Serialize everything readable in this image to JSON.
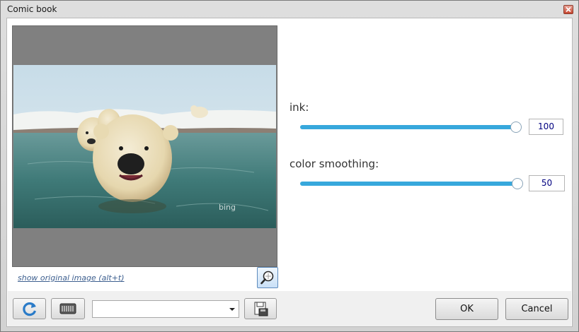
{
  "window": {
    "title": "Comic book"
  },
  "preview": {
    "show_original_label": "show original image (alt+t)",
    "watermark": "bing"
  },
  "params": {
    "ink": {
      "label": "ink:",
      "value": "100",
      "fraction": 1.0
    },
    "color_smoothing": {
      "label": "color smoothing:",
      "value": "50",
      "fraction": 1.0
    }
  },
  "footer": {
    "preset_value": "",
    "ok_label": "OK",
    "cancel_label": "Cancel"
  },
  "icons": {
    "close": "close-icon",
    "zoom": "magnifier-icon",
    "reset": "refresh-icon",
    "presets": "keyboard-icon",
    "save": "floppy-save-icon"
  },
  "colors": {
    "slider_accent": "#37a8dc",
    "value_text": "#000080",
    "link_text": "#3d5f8f"
  }
}
